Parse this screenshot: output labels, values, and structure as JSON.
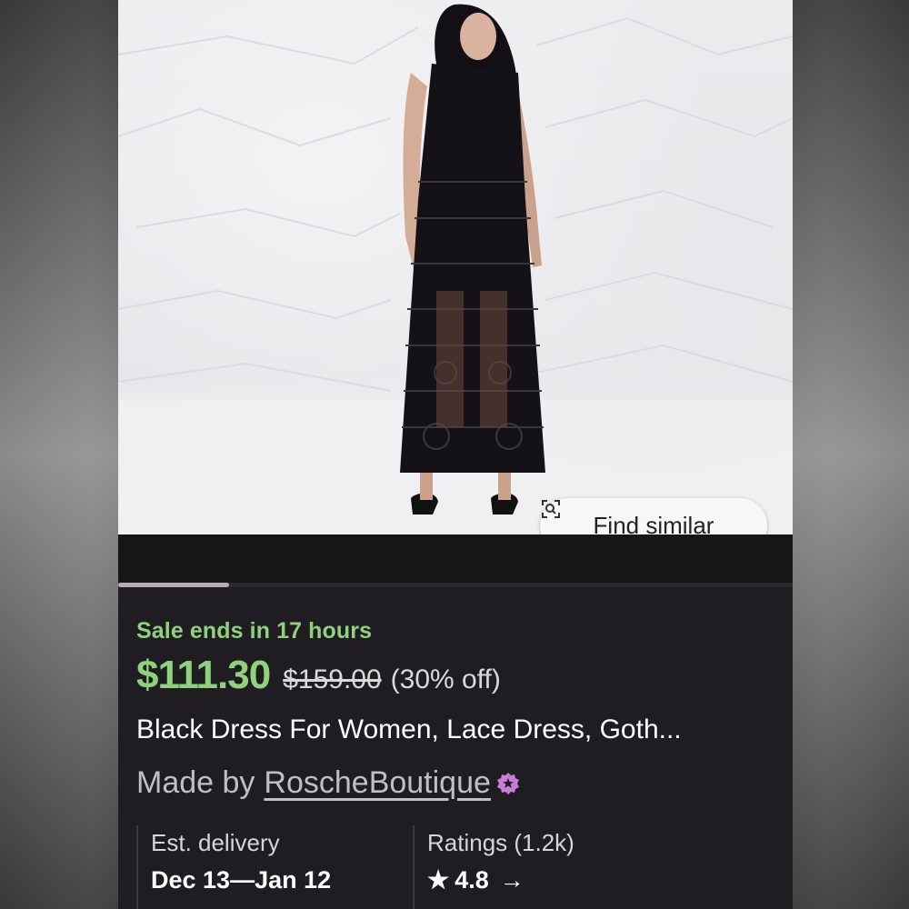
{
  "product_image": {
    "alt": ""
  },
  "find_similar": {
    "label": "Find similar",
    "icon": "image-search-icon"
  },
  "carousel": {
    "active_index": 0
  },
  "listing": {
    "sale_text": "Sale ends in 17 hours",
    "price": "$111.30",
    "original_price": "$159.00",
    "discount": "(30% off)",
    "title": "Black Dress For Women, Lace Dress, Goth...",
    "made_by_prefix": "Made by",
    "shop_name": "RoscheBoutique",
    "shop_badge_icon": "star-seller-badge-icon"
  },
  "delivery": {
    "label": "Est. delivery",
    "value": "Dec 13—Jan 12"
  },
  "ratings": {
    "label": "Ratings (1.2k)",
    "star": "★",
    "value": "4.8",
    "arrow": "→"
  },
  "colors": {
    "sale_green": "#8fd17d",
    "background": "#1f1d22",
    "badge_purple": "#c77dd6"
  }
}
